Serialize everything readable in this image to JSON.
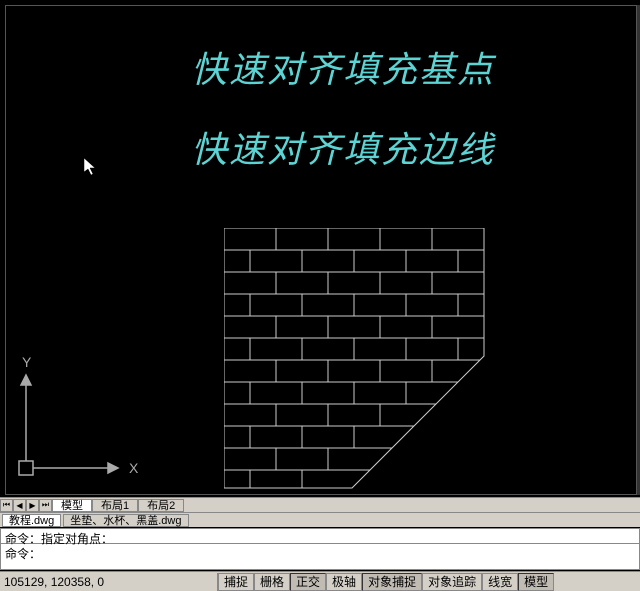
{
  "annotations": {
    "line1": "快速对齐填充基点",
    "line2": "快速对齐填充边线"
  },
  "ucs": {
    "x_label": "X",
    "y_label": "Y"
  },
  "tabs": {
    "model": "模型",
    "layout1": "布局1",
    "layout2": "布局2"
  },
  "files": {
    "active": "教程.dwg",
    "inactive": "坐垫、水杯、黑盖.dwg"
  },
  "command": {
    "line1": "命令：指定对角点：",
    "line2": "命令："
  },
  "status": {
    "coords": "105129, 120358, 0",
    "snap": "捕捉",
    "grid": "栅格",
    "ortho": "正交",
    "polar": "极轴",
    "osnap": "对象捕捉",
    "otrack": "对象追踪",
    "lwt": "线宽",
    "model": "模型"
  }
}
